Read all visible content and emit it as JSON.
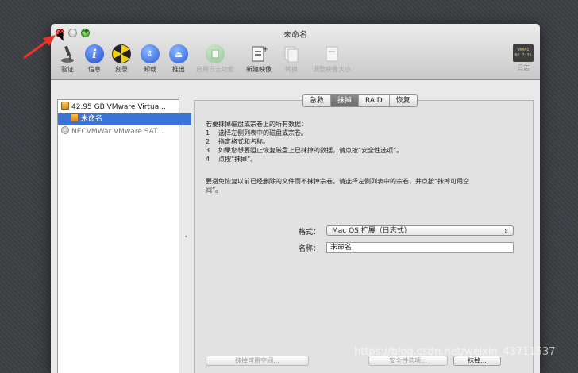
{
  "window": {
    "title": "未命名"
  },
  "toolbar": {
    "items": [
      {
        "label": "验证",
        "icon": "microscope-icon",
        "enabled": true
      },
      {
        "label": "信息",
        "icon": "info-icon",
        "enabled": true
      },
      {
        "label": "刻录",
        "icon": "burn-icon",
        "enabled": true
      },
      {
        "label": "卸载",
        "icon": "unmount-icon",
        "enabled": true
      },
      {
        "label": "推出",
        "icon": "eject-icon",
        "enabled": true
      },
      {
        "label": "启用日志功能",
        "icon": "journal-icon",
        "enabled": false
      },
      {
        "label": "新建映像",
        "icon": "new-image-icon",
        "enabled": true
      },
      {
        "label": "转换",
        "icon": "convert-icon",
        "enabled": false
      },
      {
        "label": "调整映像大小",
        "icon": "resize-image-icon",
        "enabled": false
      }
    ],
    "log": {
      "label": "日志",
      "badge_line1": "WARNI",
      "badge_line2": "NY 7:36"
    }
  },
  "sidebar": {
    "items": [
      {
        "label": "42.95 GB VMware Virtua...",
        "type": "disk",
        "selected": false
      },
      {
        "label": "未命名",
        "type": "volume",
        "selected": true
      },
      {
        "label": "NECVMWar VMware SAT...",
        "type": "optical",
        "selected": false
      }
    ]
  },
  "tabs": [
    {
      "label": "急救",
      "active": false
    },
    {
      "label": "抹掉",
      "active": true
    },
    {
      "label": "RAID",
      "active": false
    },
    {
      "label": "恢复",
      "active": false
    }
  ],
  "erase": {
    "intro": "若要抹掉磁盘或宗卷上的所有数据：",
    "steps": [
      {
        "num": "1",
        "text": "选择左侧列表中的磁盘或宗卷。"
      },
      {
        "num": "2",
        "text": "指定格式和名称。"
      },
      {
        "num": "3",
        "text": "如果您想要阻止恢复磁盘上已抹掉的数据，请点按“安全性选项”。"
      },
      {
        "num": "4",
        "text": "点按“抹掉”。"
      }
    ],
    "note_line1": "要避免恢复以前已经删除的文件而不抹掉宗卷，请选择左侧列表中的宗卷，并点按“抹掉可用空",
    "note_line2": "间”。",
    "format_label": "格式：",
    "format_value": "Mac OS 扩展（日志式）",
    "name_label": "名称：",
    "name_value": "未命名",
    "erase_free_space_button": "抹掉可用空间...",
    "security_options_button": "安全性选项...",
    "erase_button": "抹掉..."
  },
  "watermark": "https://blog.csdn.net/weixin_43711537",
  "colors": {
    "selection": "#3875d7",
    "annotation_arrow": "#e8332b"
  }
}
